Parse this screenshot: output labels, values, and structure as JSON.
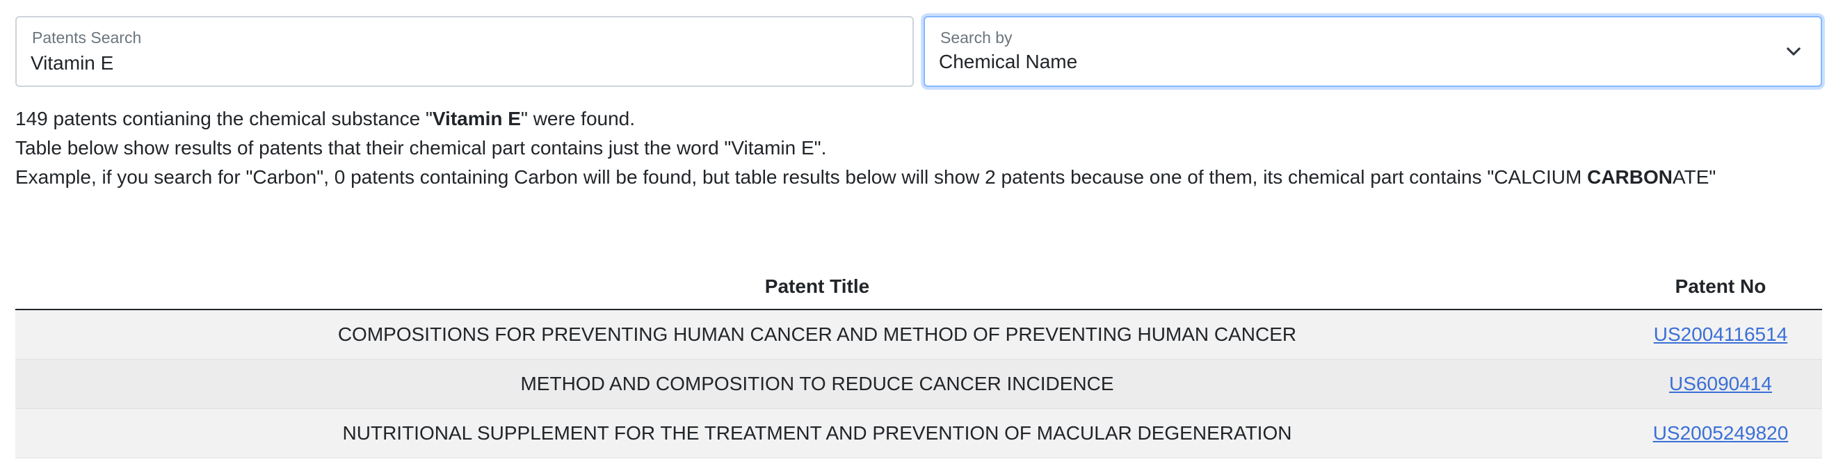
{
  "search": {
    "label": "Patents Search",
    "value": "Vitamin E"
  },
  "search_by": {
    "label": "Search by",
    "selected": "Chemical Name",
    "icon": "chevron-down-icon"
  },
  "info": {
    "line1_count": "149",
    "line1_pre": " patents contianing the chemical substance \"",
    "line1_term": "Vitamin E",
    "line1_post": "\" were found.",
    "line2": "Table below show results of patents that their chemical part contains just the word \"Vitamin E\".",
    "line3_pre": "Example, if you search for \"Carbon\", 0 patents containing Carbon will be found, but table results below will show 2 patents because one of them, its chemical part contains \"CALCIUM ",
    "line3_bold": "CARBON",
    "line3_post": "ATE\""
  },
  "table": {
    "headers": {
      "title": "Patent Title",
      "number": "Patent No"
    },
    "rows": [
      {
        "title": "COMPOSITIONS FOR PREVENTING HUMAN CANCER AND METHOD OF PREVENTING HUMAN CANCER",
        "number": "US2004116514"
      },
      {
        "title": "METHOD AND COMPOSITION TO REDUCE CANCER INCIDENCE",
        "number": "US6090414"
      },
      {
        "title": "NUTRITIONAL SUPPLEMENT FOR THE TREATMENT AND PREVENTION OF MACULAR DEGENERATION",
        "number": "US2005249820"
      }
    ]
  },
  "colors": {
    "link": "#3b6fd6",
    "focus_border": "#86b7fe",
    "row_odd": "#f2f2f2",
    "row_even": "#ececec"
  }
}
